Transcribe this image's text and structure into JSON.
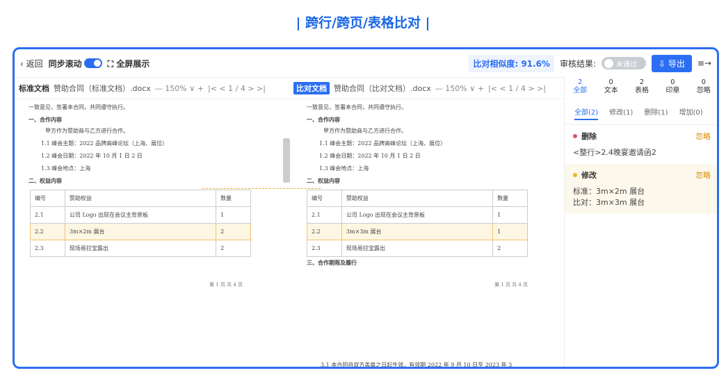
{
  "banner": "|  跨行/跨页/表格比对  |",
  "topbar": {
    "back": "‹ 返回",
    "sync_scroll": "同步滚动",
    "fullscreen": "⛶ 全屏展示",
    "similarity_label": "比对相似度:",
    "similarity_value": "91.6%",
    "review_label": "审核结果:",
    "review_toggle": "未通过",
    "export": "⇩ 导出",
    "menu_icon": "≡→"
  },
  "docbar": {
    "left": {
      "tag": "标准文档",
      "filename": "赞助合同（标准文档）.docx",
      "zoom": "—  150%  ∨  +",
      "pager": "|<  <   1  / 4  >  >|"
    },
    "right": {
      "tag": "比对文档",
      "filename": "赞助合同（比对文档）.docx",
      "zoom": "—  150%  ∨  +",
      "pager": "|<  <   1  / 4  >  >|"
    }
  },
  "doc": {
    "line1": "一致意见，签署本合同，共同遵守执行。",
    "sec1": "一、合作内容",
    "line2": "甲方作为赞助商与乙方进行合作。",
    "line3": "1.1 峰会主题：2022 品牌高峰论坛（上海、展位）",
    "line4": "1.2 峰会日期：2022 年 10 月 1 日  2 日",
    "line5": "1.3 峰会地点：上海",
    "sec2": "二、权益内容",
    "table_header": [
      "编号",
      "赞助权益",
      "数量"
    ],
    "rows_left": [
      [
        "2.1",
        "公司 Logo 出现在会议主背景板",
        "1"
      ],
      [
        "2.2",
        "3m×2m 展台",
        "2"
      ],
      [
        "2.3",
        "现场易拉宝露出",
        "2"
      ]
    ],
    "rows_right": [
      [
        "2.1",
        "公司 Logo 出现在会议主背景板",
        "1"
      ],
      [
        "2.2",
        "3m×3m 展台",
        "1"
      ],
      [
        "2.3",
        "现场易拉宝露出",
        "2"
      ]
    ],
    "sec3": "三、合作期限及履行",
    "page_num": "第 1 页 共 4 页",
    "bottom_right": "3.1 本合同自双方盖章之日起生效，有效期 2022 年 9 月 10 日至 2023 年 3"
  },
  "sidepanel": {
    "categories": [
      {
        "count": "2",
        "label": "全部",
        "icon": "doc-icon"
      },
      {
        "count": "0",
        "label": "文本",
        "icon": "text-icon"
      },
      {
        "count": "2",
        "label": "表格",
        "icon": "table-icon"
      },
      {
        "count": "0",
        "label": "印章",
        "icon": "stamp-icon"
      },
      {
        "count": "0",
        "label": "忽略",
        "icon": "eye-off-icon"
      }
    ],
    "subtabs": [
      "全部(2)",
      "修改(1)",
      "删除(1)",
      "增加(0)"
    ],
    "diff1": {
      "type": "删除",
      "ignore": "忽略",
      "text": "<整行>2.4晚宴邀请函2"
    },
    "diff2": {
      "type": "修改",
      "ignore": "忽略",
      "std": "标准：3m×2m 展台",
      "cmp": "比对：3m×3m 展台"
    },
    "colors": {
      "delete": "#e0555b",
      "modify": "#f0b429"
    }
  }
}
